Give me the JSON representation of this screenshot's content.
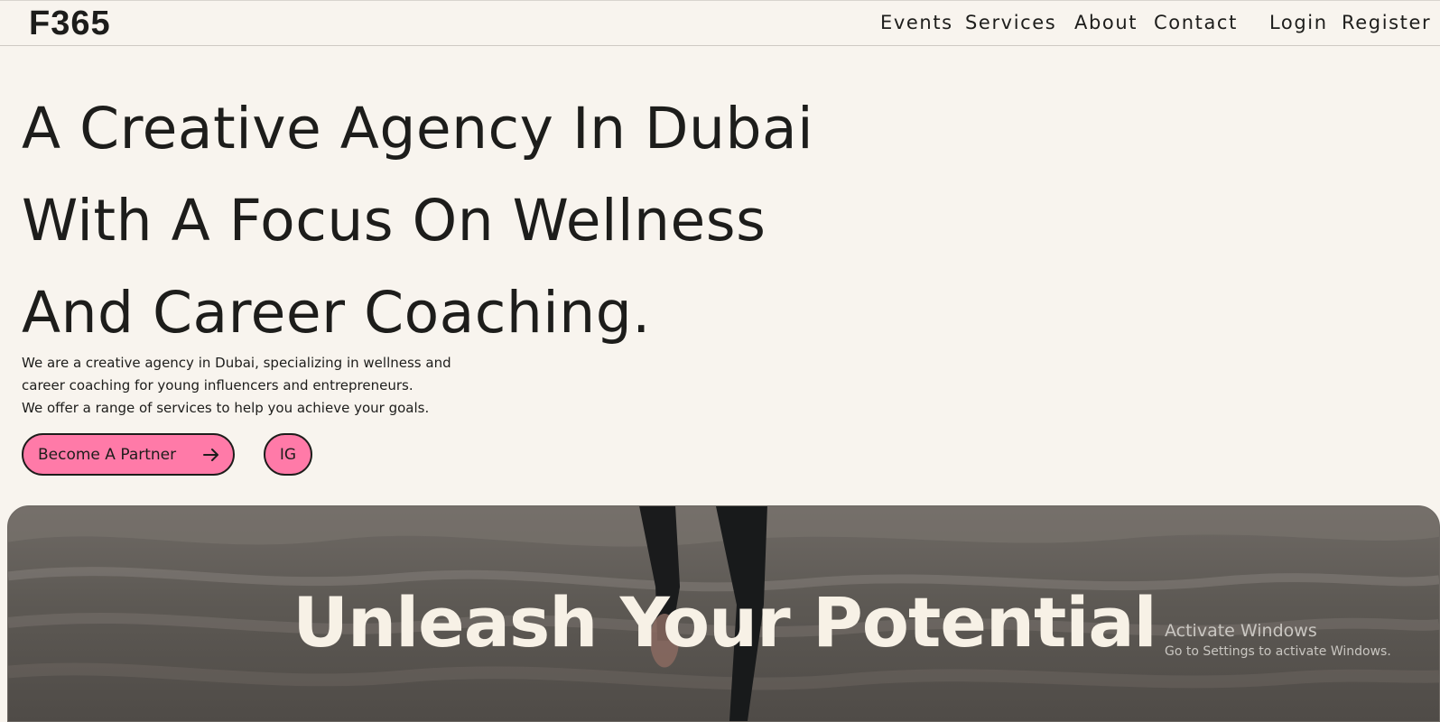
{
  "header": {
    "logo": "F365",
    "nav": {
      "events": "Events",
      "services": "Services",
      "about": "About",
      "contact": "Contact",
      "login": "Login",
      "register": "Register"
    }
  },
  "hero": {
    "title_lines": [
      "A Creative Agency In Dubai",
      "With A Focus On Wellness",
      "And Career Coaching."
    ],
    "description_lines": [
      "We are a creative agency in Dubai, specializing in wellness and",
      "career coaching for young influencers and entrepreneurs.",
      "We offer a range of services to help you achieve your goals."
    ],
    "partner_button": "Become A Partner",
    "ig_button": "IG"
  },
  "banner": {
    "title": "Unleash Your Potential"
  },
  "system_overlay": {
    "title": "Activate Windows",
    "subtitle": "Go to Settings to activate Windows."
  },
  "colors": {
    "background": "#f8f4ee",
    "text": "#1d1d1b",
    "accent_pink": "#ff7aa8",
    "banner_text": "#f7f1e6"
  },
  "icons": {
    "partner_button_icon": "arrow-right-icon"
  }
}
